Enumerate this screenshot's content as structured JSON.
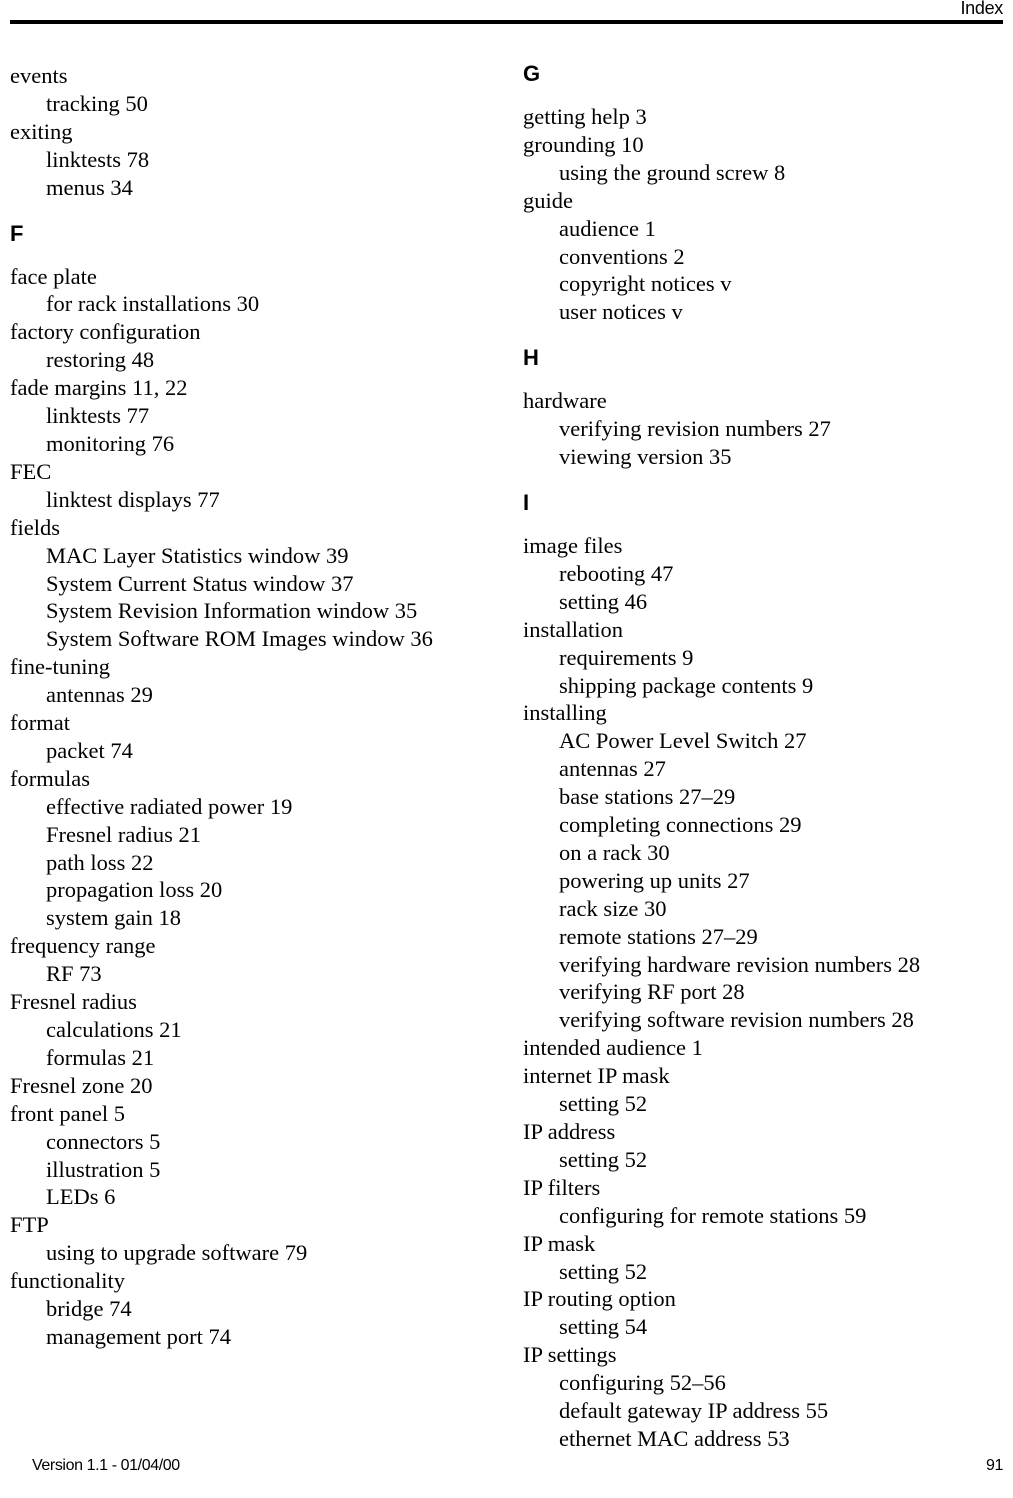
{
  "header": {
    "title": "Index"
  },
  "footer": {
    "version": "Version 1.1 - 01/04/00",
    "page_number": "91"
  },
  "columns": [
    {
      "name": "left-column",
      "blocks": [
        {
          "type": "entries",
          "entries": [
            {
              "level": 1,
              "text": "events"
            },
            {
              "level": 2,
              "text": "tracking 50"
            },
            {
              "level": 1,
              "text": "exiting"
            },
            {
              "level": 2,
              "text": "linktests 78"
            },
            {
              "level": 2,
              "text": "menus 34"
            }
          ]
        },
        {
          "type": "letter",
          "letter": "F"
        },
        {
          "type": "entries",
          "entries": [
            {
              "level": 1,
              "text": "face plate"
            },
            {
              "level": 2,
              "text": "for rack installations 30"
            },
            {
              "level": 1,
              "text": "factory configuration"
            },
            {
              "level": 2,
              "text": "restoring 48"
            },
            {
              "level": 1,
              "text": "fade margins 11, 22"
            },
            {
              "level": 2,
              "text": "linktests 77"
            },
            {
              "level": 2,
              "text": "monitoring 76"
            },
            {
              "level": 1,
              "text": "FEC"
            },
            {
              "level": 2,
              "text": "linktest displays 77"
            },
            {
              "level": 1,
              "text": "fields"
            },
            {
              "level": 2,
              "text": "MAC Layer Statistics window 39"
            },
            {
              "level": 2,
              "text": "System Current Status window 37"
            },
            {
              "level": 2,
              "text": "System Revision Information window 35"
            },
            {
              "level": 2,
              "text": "System Software ROM Images window 36"
            },
            {
              "level": 1,
              "text": "fine-tuning"
            },
            {
              "level": 2,
              "text": "antennas 29"
            },
            {
              "level": 1,
              "text": "format"
            },
            {
              "level": 2,
              "text": "packet 74"
            },
            {
              "level": 1,
              "text": "formulas"
            },
            {
              "level": 2,
              "text": "effective radiated power 19"
            },
            {
              "level": 2,
              "text": "Fresnel radius 21"
            },
            {
              "level": 2,
              "text": "path loss 22"
            },
            {
              "level": 2,
              "text": "propagation loss 20"
            },
            {
              "level": 2,
              "text": "system gain 18"
            },
            {
              "level": 1,
              "text": "frequency range"
            },
            {
              "level": 2,
              "text": "RF 73"
            },
            {
              "level": 1,
              "text": "Fresnel radius"
            },
            {
              "level": 2,
              "text": "calculations 21"
            },
            {
              "level": 2,
              "text": "formulas 21"
            },
            {
              "level": 1,
              "text": "Fresnel zone 20"
            },
            {
              "level": 1,
              "text": "front panel 5"
            },
            {
              "level": 2,
              "text": "connectors 5"
            },
            {
              "level": 2,
              "text": "illustration 5"
            },
            {
              "level": 2,
              "text": "LEDs 6"
            },
            {
              "level": 1,
              "text": "FTP"
            },
            {
              "level": 2,
              "text": "using to upgrade software 79"
            },
            {
              "level": 1,
              "text": "functionality"
            },
            {
              "level": 2,
              "text": "bridge 74"
            },
            {
              "level": 2,
              "text": "management port 74"
            }
          ]
        }
      ]
    },
    {
      "name": "right-column",
      "blocks": [
        {
          "type": "letter",
          "letter": "G"
        },
        {
          "type": "entries",
          "entries": [
            {
              "level": 1,
              "text": "getting help 3"
            },
            {
              "level": 1,
              "text": "grounding 10"
            },
            {
              "level": 2,
              "text": "using the ground screw 8"
            },
            {
              "level": 1,
              "text": "guide"
            },
            {
              "level": 2,
              "text": "audience 1"
            },
            {
              "level": 2,
              "text": "conventions 2"
            },
            {
              "level": 2,
              "text": "copyright notices v"
            },
            {
              "level": 2,
              "text": "user notices v"
            }
          ]
        },
        {
          "type": "letter",
          "letter": "H"
        },
        {
          "type": "entries",
          "entries": [
            {
              "level": 1,
              "text": "hardware"
            },
            {
              "level": 2,
              "text": "verifying revision numbers 27"
            },
            {
              "level": 2,
              "text": "viewing version 35"
            }
          ]
        },
        {
          "type": "letter",
          "letter": "I"
        },
        {
          "type": "entries",
          "entries": [
            {
              "level": 1,
              "text": "image files"
            },
            {
              "level": 2,
              "text": "rebooting 47"
            },
            {
              "level": 2,
              "text": "setting 46"
            },
            {
              "level": 1,
              "text": "installation"
            },
            {
              "level": 2,
              "text": "requirements 9"
            },
            {
              "level": 2,
              "text": "shipping package contents 9"
            },
            {
              "level": 1,
              "text": "installing"
            },
            {
              "level": 2,
              "text": "AC Power Level Switch 27"
            },
            {
              "level": 2,
              "text": "antennas 27"
            },
            {
              "level": 2,
              "text": "base stations 27–29"
            },
            {
              "level": 2,
              "text": "completing connections 29"
            },
            {
              "level": 2,
              "text": "on a rack 30"
            },
            {
              "level": 2,
              "text": "powering up units 27"
            },
            {
              "level": 2,
              "text": "rack size 30"
            },
            {
              "level": 2,
              "text": "remote stations 27–29"
            },
            {
              "level": 2,
              "text": "verifying hardware revision numbers 28"
            },
            {
              "level": 2,
              "text": "verifying RF port 28"
            },
            {
              "level": 2,
              "text": "verifying software revision numbers 28"
            },
            {
              "level": 1,
              "text": "intended audience 1"
            },
            {
              "level": 1,
              "text": "internet IP mask"
            },
            {
              "level": 2,
              "text": "setting 52"
            },
            {
              "level": 1,
              "text": "IP address"
            },
            {
              "level": 2,
              "text": "setting 52"
            },
            {
              "level": 1,
              "text": "IP filters"
            },
            {
              "level": 2,
              "text": "configuring for remote stations 59"
            },
            {
              "level": 1,
              "text": "IP mask"
            },
            {
              "level": 2,
              "text": "setting 52"
            },
            {
              "level": 1,
              "text": "IP routing option"
            },
            {
              "level": 2,
              "text": "setting 54"
            },
            {
              "level": 1,
              "text": "IP settings"
            },
            {
              "level": 2,
              "text": "configuring 52–56"
            },
            {
              "level": 2,
              "text": "default gateway IP address 55"
            },
            {
              "level": 2,
              "text": "ethernet MAC address 53"
            }
          ]
        }
      ]
    }
  ]
}
